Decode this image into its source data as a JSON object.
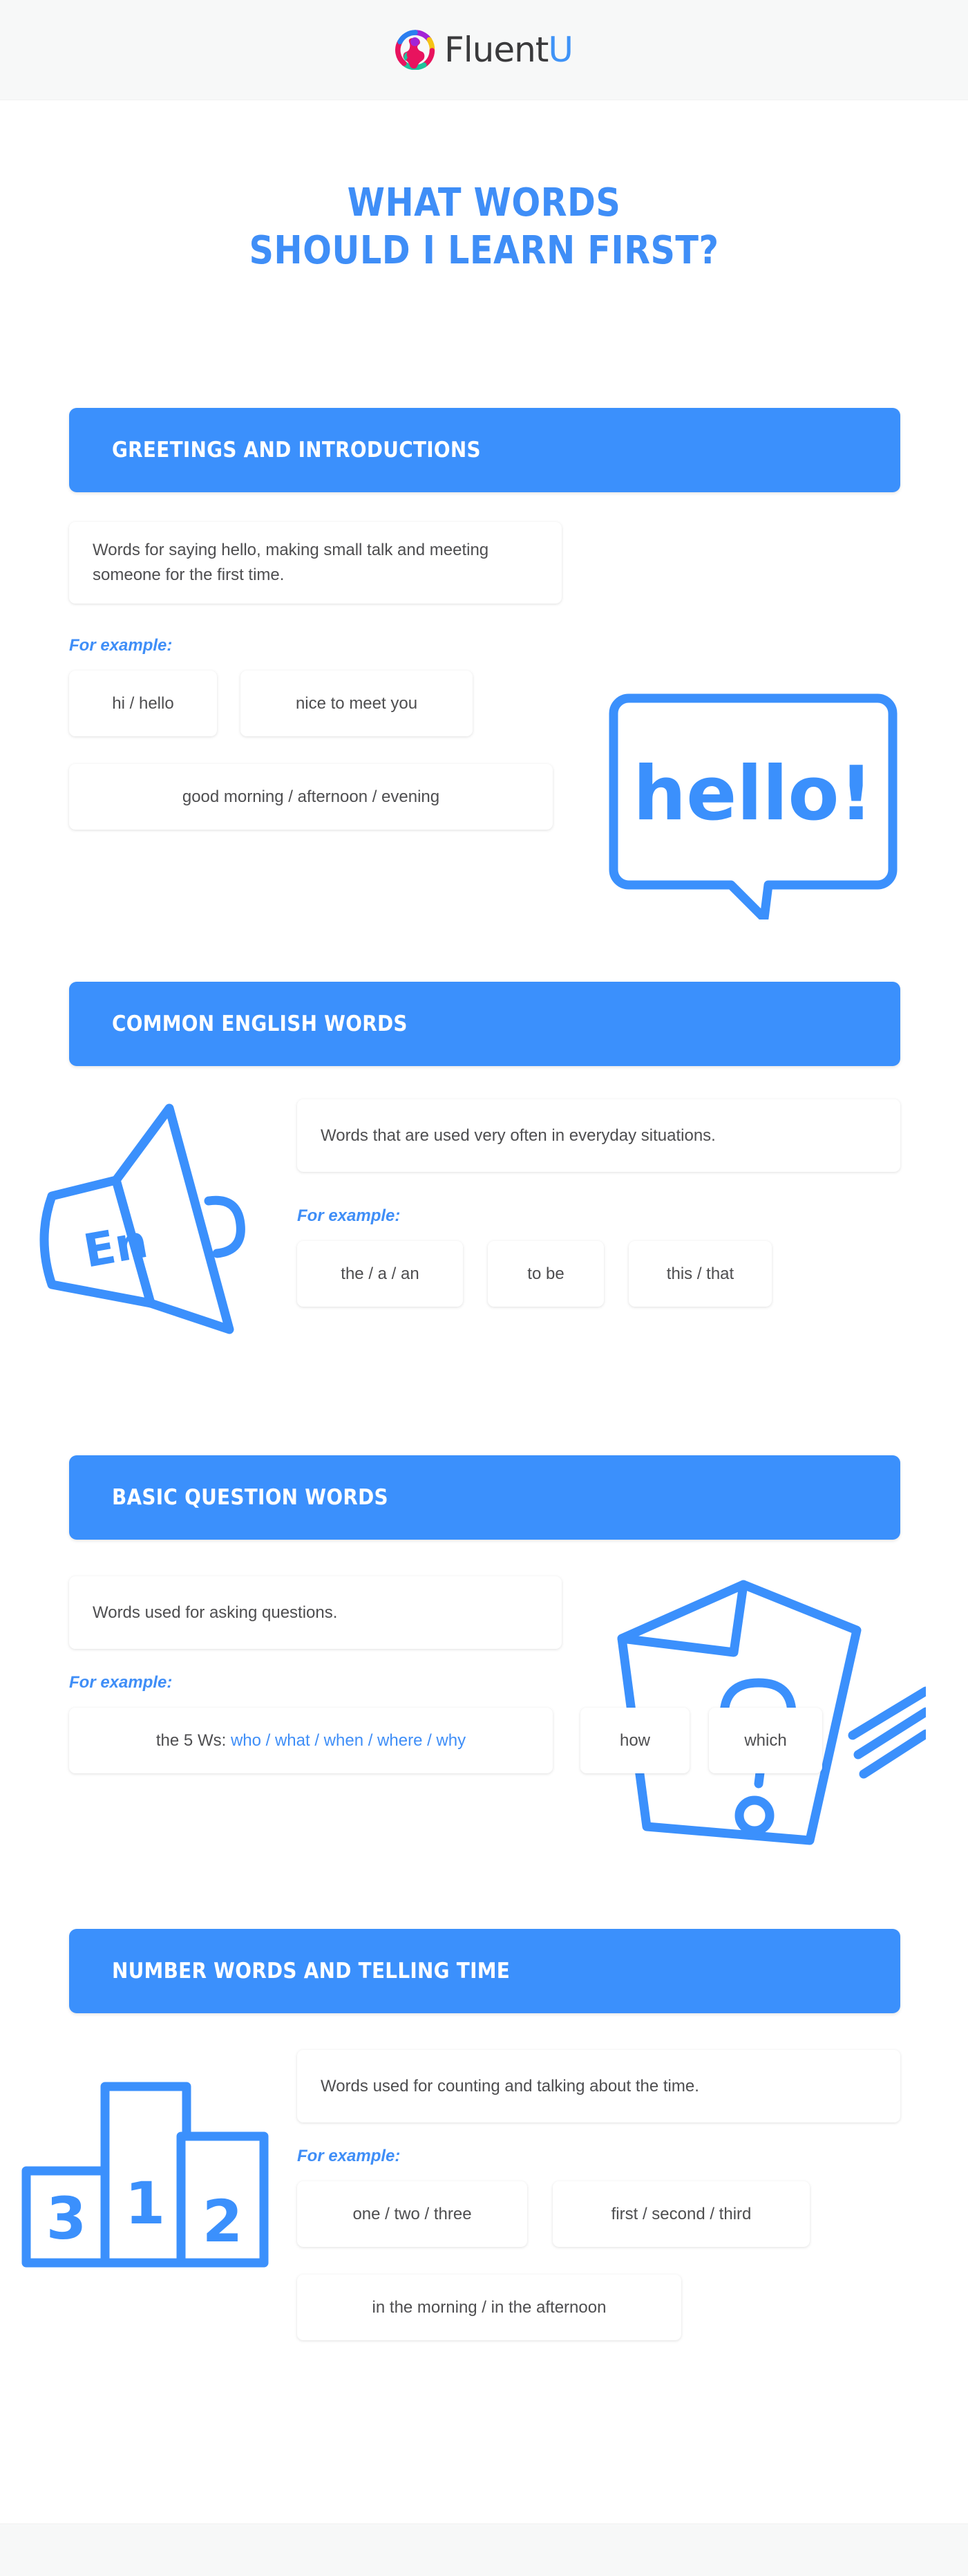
{
  "brand": {
    "name_first": "Fluent",
    "name_last": "U",
    "logo_icon": "fluentu-globe-icon"
  },
  "title": {
    "line1": "WHAT WORDS",
    "line2": "SHOULD I LEARN FIRST?",
    "color": "#3f8ef7"
  },
  "theme": {
    "accent_blue": "#3b90fc",
    "text_gray": "#4e4e50",
    "band_gray": "#f7f8f8"
  },
  "example_label": "For example:",
  "sections": [
    {
      "id": "greetings-and-introductions",
      "header": "GREETINGS AND INTRODUCTIONS",
      "description": "Words for saying hello, making small talk and meeting someone for the first time.",
      "illustration": "speech-bubble-hello-icon",
      "illustration_text": "hello!",
      "chips": [
        "hi / hello",
        "nice to meet you",
        "good morning / afternoon / evening"
      ]
    },
    {
      "id": "common-english-words",
      "header": "COMMON ENGLISH WORDS",
      "description": "Words that are used very often in everyday situations.",
      "illustration": "megaphone-en-icon",
      "illustration_text": "En",
      "chips": [
        "the / a / an",
        "to be",
        "this / that"
      ]
    },
    {
      "id": "basic-question-words",
      "header": "BASIC QUESTION WORDS",
      "description": "Words used for asking questions.",
      "illustration": "question-paper-pencil-icon",
      "chips": [
        {
          "prefix": "the 5 Ws: ",
          "highlight": "who / what / when / where / why"
        },
        "how",
        "which"
      ]
    },
    {
      "id": "number-words-and-telling-time",
      "header": "NUMBER WORDS AND TELLING TIME",
      "description": "Words used for counting and talking about the time.",
      "illustration": "podium-ranking-icon",
      "illustration_labels": [
        "3",
        "1",
        "2"
      ],
      "chips": [
        "one / two / three",
        "first / second / third",
        "in the morning / in the afternoon"
      ]
    }
  ]
}
